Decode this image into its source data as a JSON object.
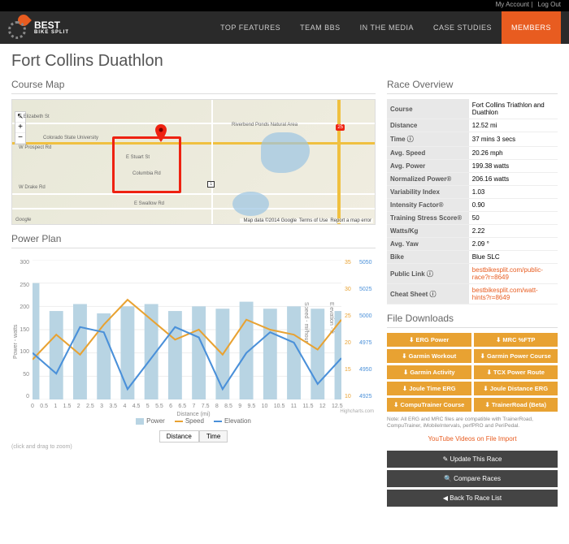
{
  "topbar": {
    "account": "My Account",
    "logout": "Log Out"
  },
  "brand": {
    "name": "BEST",
    "sub": "BIKE SPLIT"
  },
  "nav": [
    "TOP FEATURES",
    "TEAM BBS",
    "IN THE MEDIA",
    "CASE STUDIES",
    "MEMBERS"
  ],
  "nav_active": 4,
  "title": "Fort Collins Duathlon",
  "map": {
    "heading": "Course Map",
    "labels": {
      "csu": "Colorado State University",
      "rp": "Riverbend Ponds Natural Area",
      "elizabeth": "E Elizabeth St",
      "prospect": "W Prospect Rd",
      "drake": "W Drake Rd",
      "stuart": "E Stuart St",
      "columbia": "Columbia Rd",
      "swallow": "E Swallow Rd",
      "google": "Google",
      "i25": "25",
      "hwy": "1"
    },
    "attr": {
      "data": "Map data ©2014 Google",
      "tou": "Terms of Use",
      "report": "Report a map error"
    }
  },
  "plan": {
    "heading": "Power Plan",
    "ylabel_l": "Power - watts",
    "ylabel_r1": "Speed - mi/hour",
    "ylabel_r2": "Elevation - ft",
    "xlabel": "Distance (mi)",
    "y_l": [
      300,
      250,
      200,
      150,
      100,
      50,
      0
    ],
    "y_r1": [
      35,
      30,
      25,
      20,
      15,
      10
    ],
    "y_r2": [
      5050,
      5025,
      5000,
      4975,
      4950,
      4925
    ],
    "x": [
      0,
      0.5,
      1,
      1.5,
      2,
      2.5,
      3,
      3.5,
      4,
      4.5,
      5,
      5.5,
      6,
      6.5,
      7,
      7.5,
      8,
      8.5,
      9,
      9.5,
      10,
      10.5,
      11,
      11.5,
      12,
      12.5
    ],
    "legend": {
      "power": "Power",
      "speed": "Speed",
      "elev": "Elevation"
    },
    "toggle": [
      "Distance",
      "Time"
    ],
    "toggle_active": 0,
    "hint": "(click and drag to zoom)",
    "credit": "Highcharts.com"
  },
  "chart_data": {
    "type": "line",
    "x": [
      0,
      1,
      2,
      3,
      4,
      5,
      6,
      7,
      8,
      9,
      10,
      11,
      12,
      12.5
    ],
    "series": [
      {
        "name": "Power",
        "values": [
          250,
          190,
          205,
          185,
          200,
          205,
          190,
          200,
          195,
          210,
          195,
          200,
          195,
          190
        ]
      },
      {
        "name": "Speed",
        "values": [
          16,
          21,
          17,
          23,
          28,
          24,
          20,
          22,
          17,
          24,
          22,
          21,
          18,
          24
        ]
      },
      {
        "name": "Elevation",
        "values": [
          4965,
          4945,
          4990,
          4985,
          4930,
          4960,
          4990,
          4980,
          4930,
          4965,
          4985,
          4975,
          4935,
          4960
        ]
      }
    ],
    "ylabel": "Power - watts",
    "xlabel": "Distance (mi)",
    "ylim": [
      0,
      300
    ]
  },
  "overview": {
    "heading": "Race Overview",
    "rows": [
      [
        "Course",
        "Fort Collins Triathlon and Duathlon"
      ],
      [
        "Distance",
        "12.52 mi"
      ],
      [
        "Time ⓘ",
        "37 mins 3 secs"
      ],
      [
        "Avg. Speed",
        "20.26 mph"
      ],
      [
        "Avg. Power",
        "199.38 watts"
      ],
      [
        "Normalized Power®",
        "206.16 watts"
      ],
      [
        "Variability Index",
        "1.03"
      ],
      [
        "Intensity Factor®",
        "0.90"
      ],
      [
        "Training Stress Score®",
        "50"
      ],
      [
        "Watts/Kg",
        "2.22"
      ],
      [
        "Avg. Yaw",
        "2.09 °"
      ],
      [
        "Bike",
        "Blue SLC"
      ],
      [
        "Public Link ⓘ",
        "bestbikesplit.com/public-race?r=8649"
      ],
      [
        "Cheat Sheet ⓘ",
        "bestbikesplit.com/watt-hints?r=8649"
      ]
    ],
    "link_rows": [
      12,
      13
    ]
  },
  "downloads": {
    "heading": "File Downloads",
    "items": [
      "ERG Power",
      "MRC %FTP",
      "Garmin Workout",
      "Garmin Power Course",
      "Garmin Activity",
      "TCX Power Route",
      "Joule Time ERG",
      "Joule Distance ERG",
      "CompuTrainer Course",
      "TrainerRoad (Beta)"
    ],
    "note": "Note: All ERG and MRC files are compatible with TrainerRoad, CompuTrainer, iMobileIntervals, perfPRO and PeriPedal.",
    "yt": "YouTube Videos on File Import"
  },
  "actions": [
    "✎ Update This Race",
    "🔍 Compare Races",
    "◀ Back To Race List"
  ]
}
